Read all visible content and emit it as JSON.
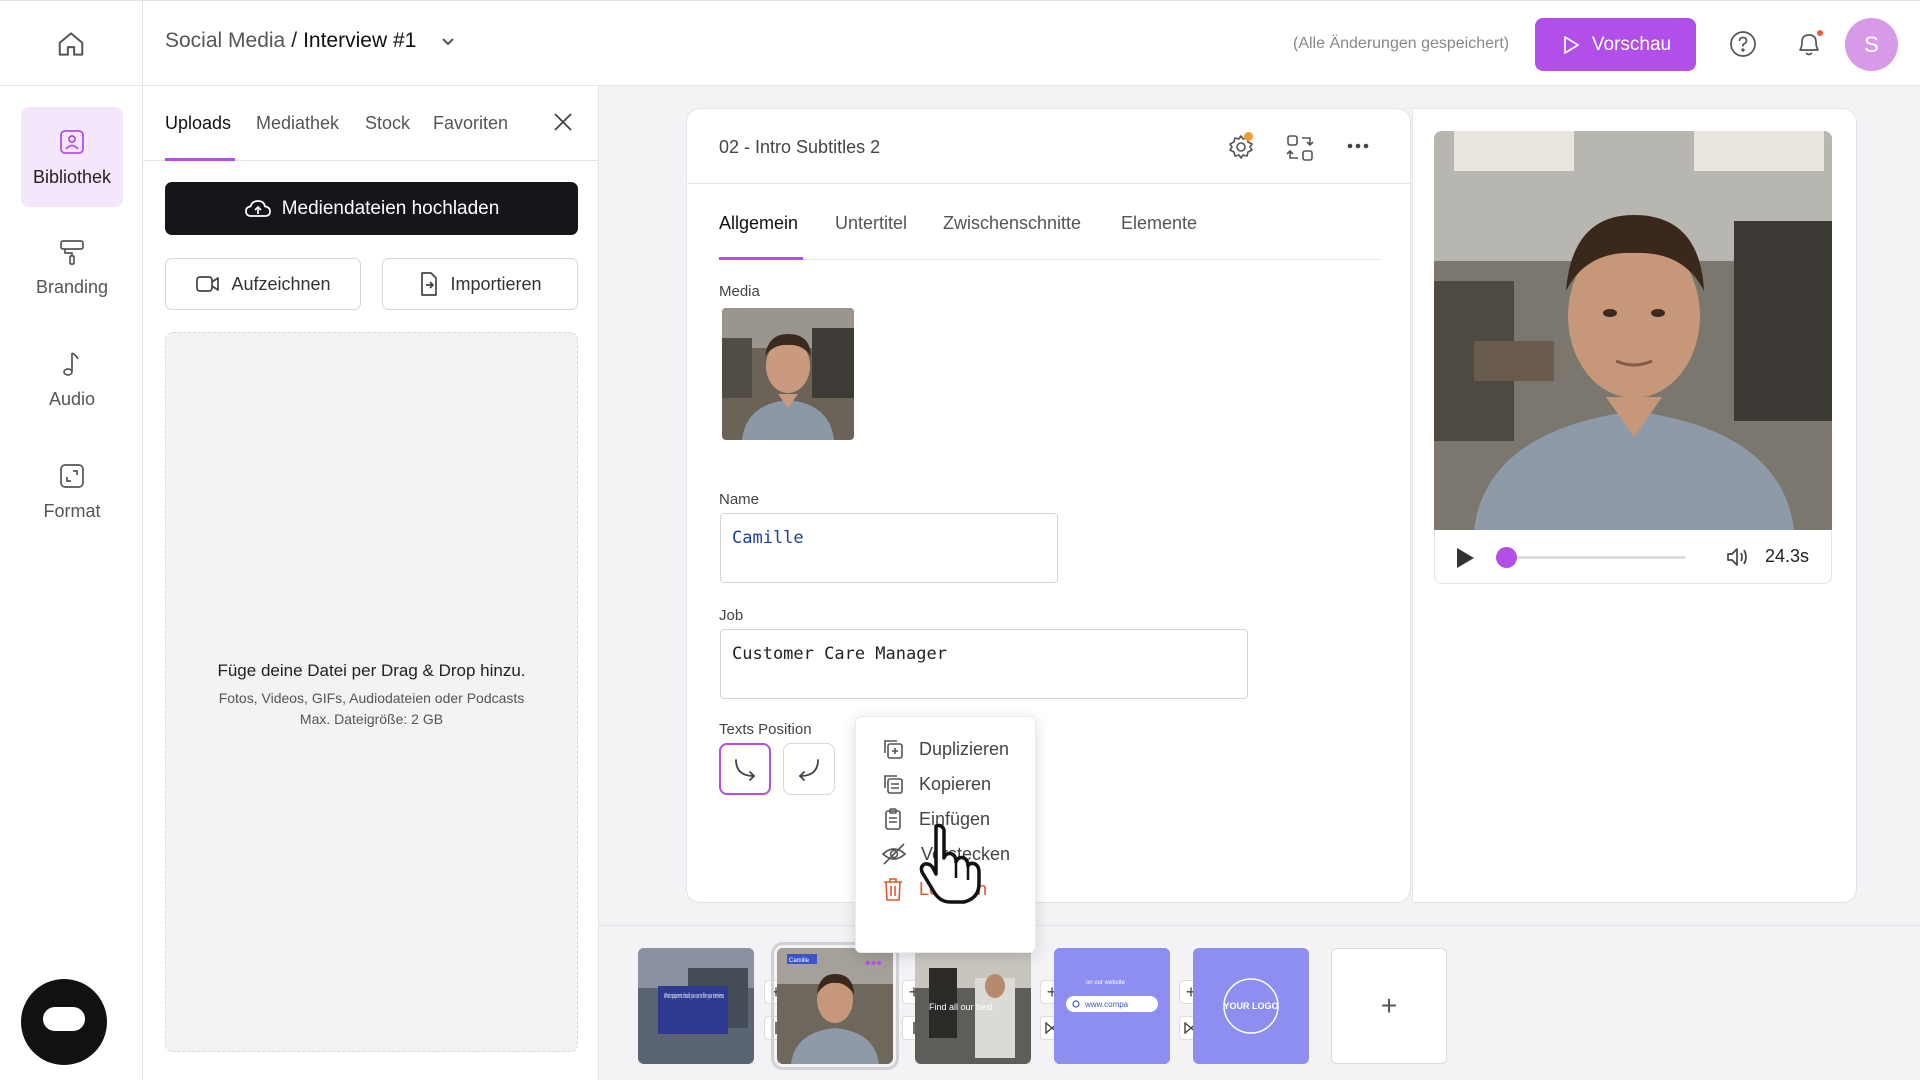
{
  "header": {
    "project": "Social Media",
    "separator": "/",
    "current": "Interview #1",
    "saved_status": "(Alle Änderungen gespeichert)",
    "preview_label": "Vorschau",
    "avatar_initial": "S"
  },
  "rail": {
    "items": [
      {
        "label": "Bibliothek",
        "icon": "image-library-icon",
        "active": true
      },
      {
        "label": "Branding",
        "icon": "paint-roller-icon",
        "active": false
      },
      {
        "label": "Audio",
        "icon": "music-note-icon",
        "active": false
      },
      {
        "label": "Format",
        "icon": "crop-frame-icon",
        "active": false
      }
    ]
  },
  "library": {
    "tabs": [
      "Uploads",
      "Mediathek",
      "Stock",
      "Favoriten"
    ],
    "active_tab": "Uploads",
    "upload_label": "Mediendateien hochladen",
    "record_label": "Aufzeichnen",
    "import_label": "Importieren",
    "drop_title": "Füge deine Datei per Drag & Drop hinzu.",
    "drop_types": "Fotos, Videos, GIFs, Audiodateien oder Podcasts",
    "drop_limit": "Max. Dateigröße: 2 GB"
  },
  "editor": {
    "title": "02 - Intro Subtitles 2",
    "tabs": [
      "Allgemein",
      "Untertitel",
      "Zwischenschnitte",
      "Elemente"
    ],
    "active_tab": "Allgemein",
    "media_label": "Media",
    "name_label": "Name",
    "name_value": "Camille",
    "job_label": "Job",
    "job_value": "Customer Care Manager",
    "position_label": "Texts Position"
  },
  "context_menu": {
    "items": [
      {
        "label": "Duplizieren",
        "icon": "duplicate-icon"
      },
      {
        "label": "Kopieren",
        "icon": "copy-icon"
      },
      {
        "label": "Einfügen",
        "icon": "paste-icon"
      },
      {
        "label": "Verstecken",
        "icon": "eye-off-icon"
      },
      {
        "label": "Löschen",
        "icon": "trash-icon",
        "danger": true
      }
    ]
  },
  "preview": {
    "duration": "24.3s",
    "progress": 0.0
  },
  "timeline": {
    "clips": [
      {
        "text": "What equipment should you use to film your interviews"
      },
      {
        "text": "Camille"
      },
      {
        "text": "Find all our best"
      },
      {
        "text": "www.compa",
        "small": "on our website"
      },
      {
        "text": "YOUR LOGO"
      }
    ]
  },
  "colors": {
    "accent": "#b14fe8",
    "danger": "#e0572e",
    "notification": "#f05a3a"
  }
}
